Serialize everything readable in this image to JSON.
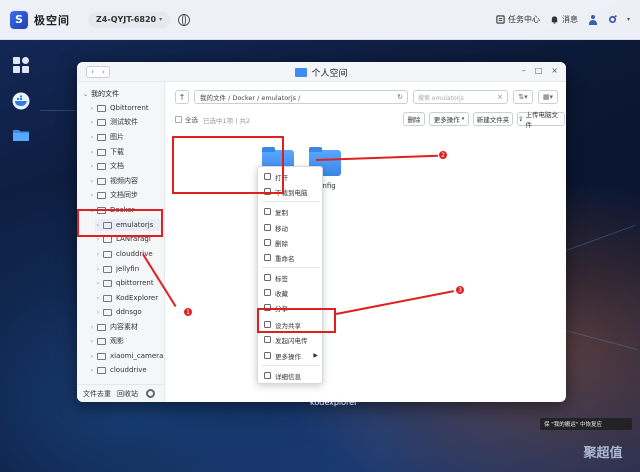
{
  "app": {
    "name": "极空间",
    "logo_letter": "S",
    "device": "Z4-QYJT-6820",
    "task_center": "任务中心",
    "messages": "消息"
  },
  "window": {
    "title": "个人空间",
    "controls": [
      "–",
      "□",
      "×"
    ]
  },
  "sidebar": {
    "header": "我的文件",
    "items": [
      {
        "label": "Qbittorrent"
      },
      {
        "label": "测试软件"
      },
      {
        "label": "图片"
      },
      {
        "label": "下载"
      },
      {
        "label": "文档"
      },
      {
        "label": "视频内容"
      },
      {
        "label": "文档同步"
      },
      {
        "label": "Docker"
      },
      {
        "label": "emulatorjs"
      },
      {
        "label": "LANraragi"
      },
      {
        "label": "clouddrive"
      },
      {
        "label": "jellyfin"
      },
      {
        "label": "qbittorrent"
      },
      {
        "label": "KodExplorer"
      },
      {
        "label": "ddnsgo"
      },
      {
        "label": "内容素材"
      },
      {
        "label": "观影"
      },
      {
        "label": "xiaomi_camera"
      },
      {
        "label": "clouddrive"
      }
    ],
    "footer": {
      "deduplicate": "文件去重",
      "recycle": "回收站"
    }
  },
  "main": {
    "path": "我的文件 / Docker / emulatorjs /",
    "search_placeholder": "搜索 emulatorjs",
    "select_all": "全选",
    "selected_count": "已选中1项 | 共2",
    "buttons": {
      "delete": "删除",
      "more_ops": "更多操作",
      "new_folder": "新建文件夹",
      "upload": "上传电脑文件"
    },
    "files": [
      {
        "name": "data"
      },
      {
        "name": "config"
      }
    ]
  },
  "context_menu": {
    "items": [
      {
        "label": "打开"
      },
      {
        "label": "下载到电脑"
      },
      {
        "label": "复制"
      },
      {
        "label": "移动"
      },
      {
        "label": "删除"
      },
      {
        "label": "重命名"
      },
      {
        "label": "标签"
      },
      {
        "label": "收藏"
      },
      {
        "label": "分享"
      },
      {
        "label": "设为共享"
      },
      {
        "label": "发起闪电传"
      },
      {
        "label": "更多操作"
      },
      {
        "label": "详细信息"
      }
    ]
  },
  "annotations": [
    "1",
    "2",
    "3"
  ],
  "desktop": {
    "caption": "kodexplorer",
    "toast": "保 \"我的搬运\" 中恢复应",
    "watermark": "聚超值"
  }
}
